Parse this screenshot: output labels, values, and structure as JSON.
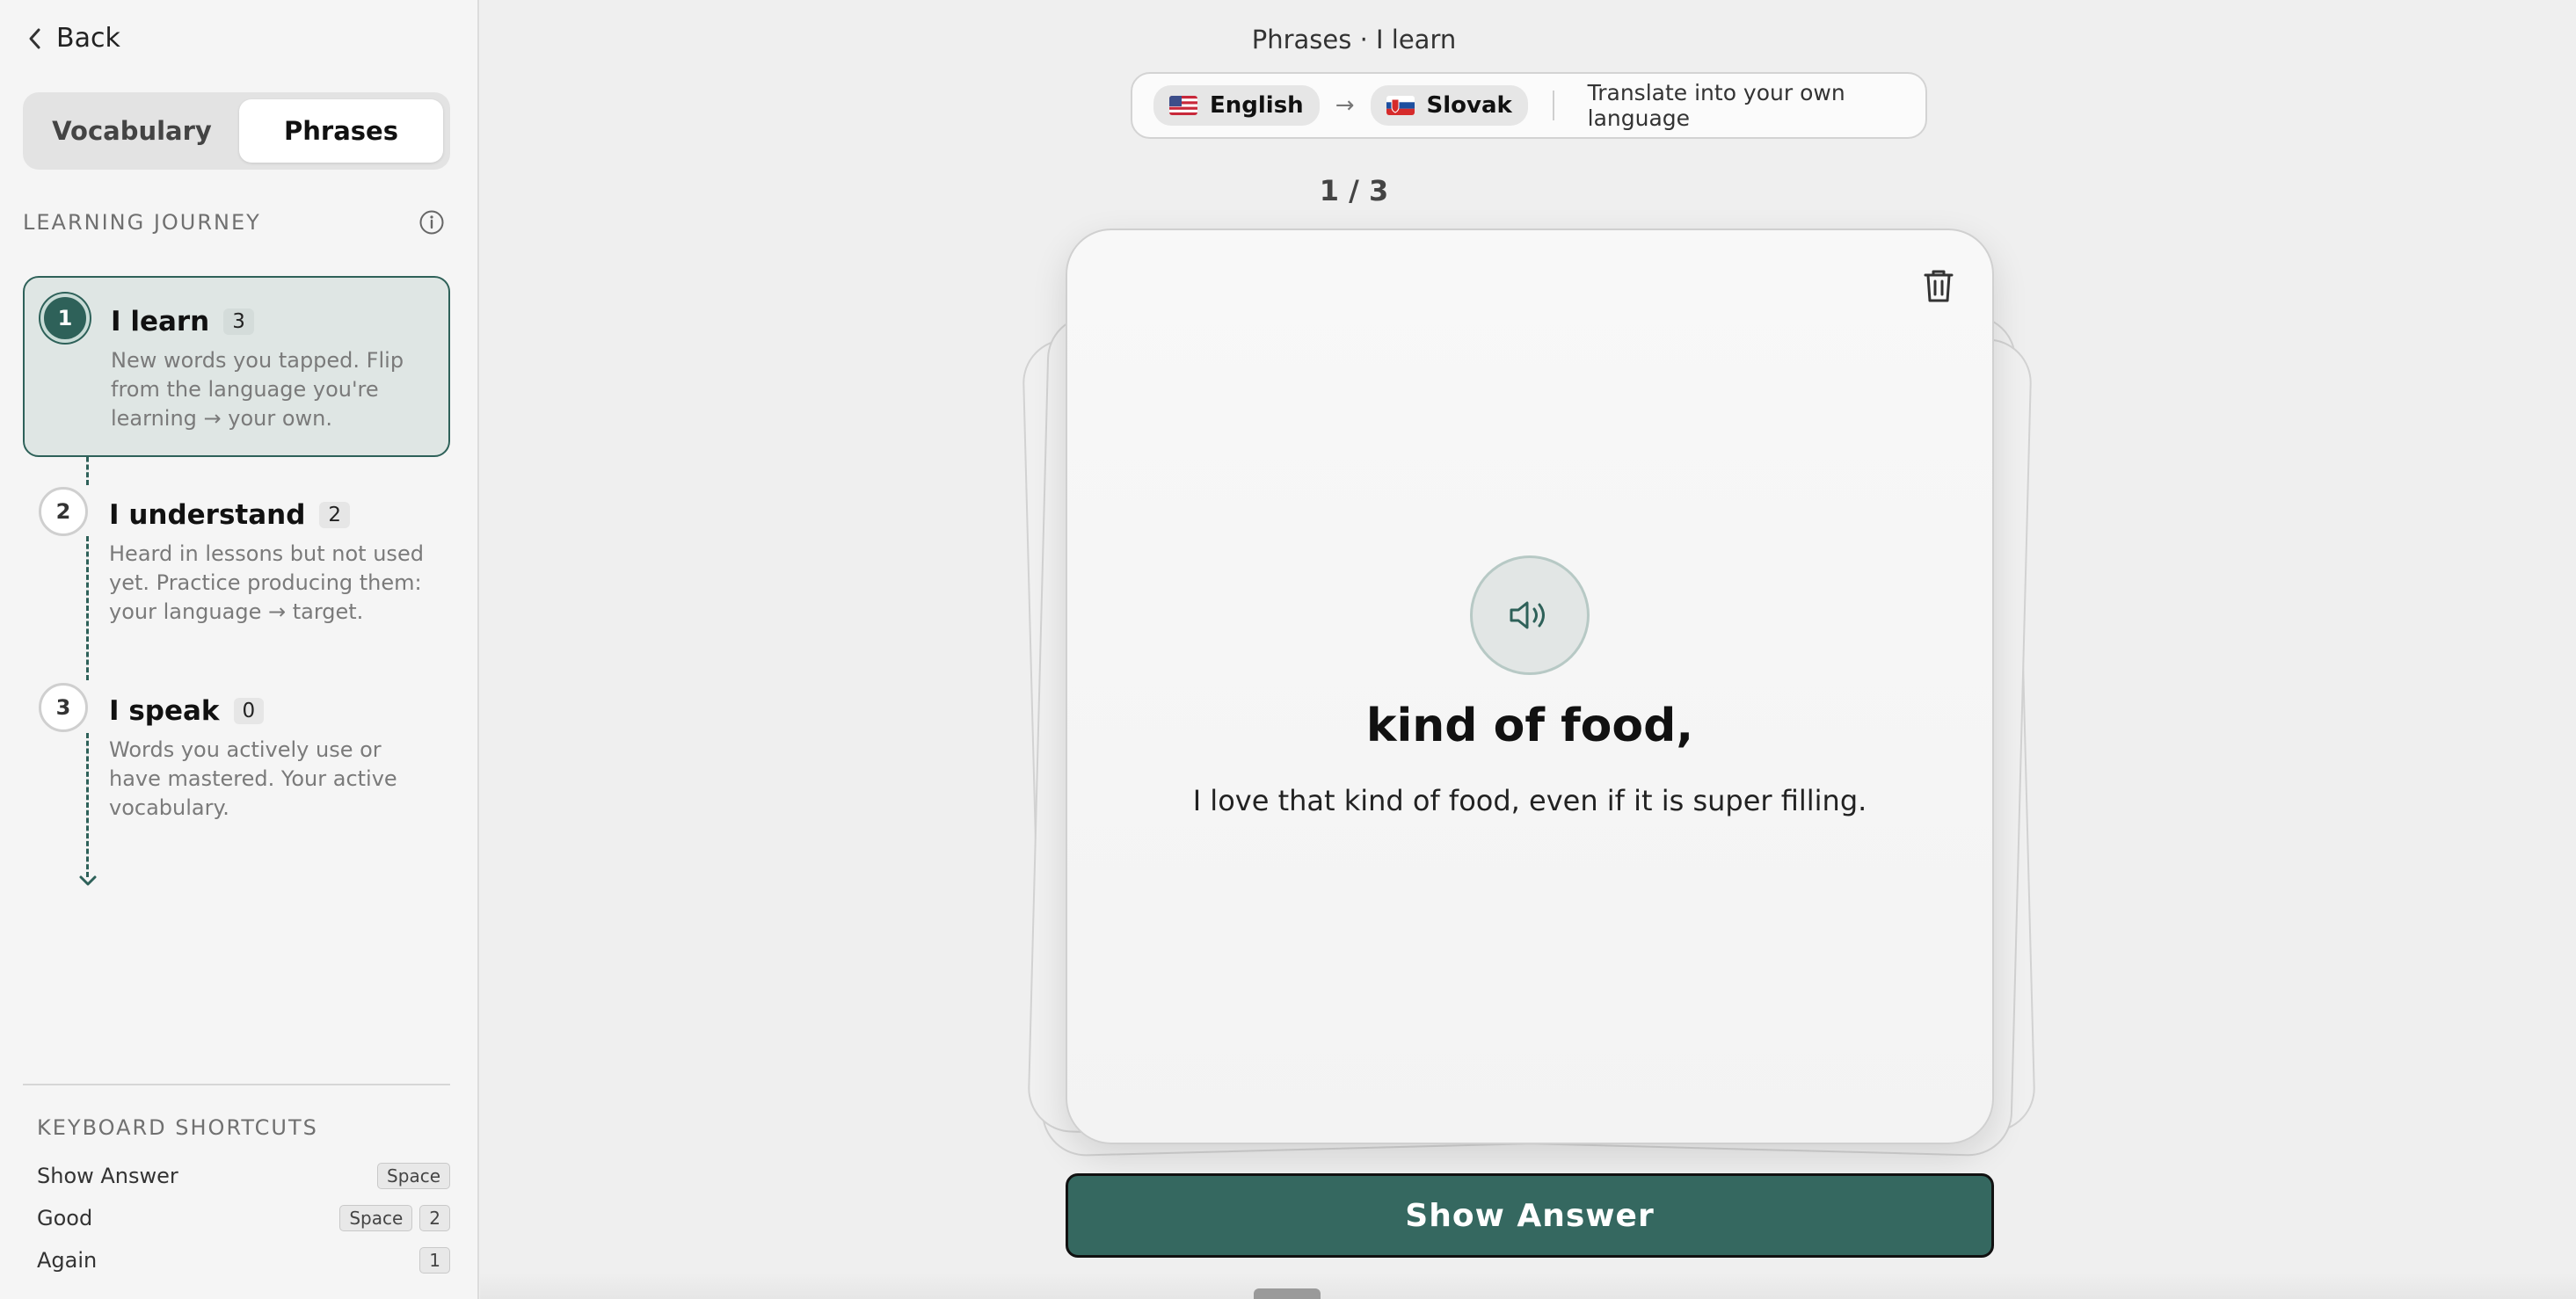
{
  "sidebar": {
    "back_label": "Back",
    "tabs": [
      {
        "label": "Vocabulary",
        "active": false
      },
      {
        "label": "Phrases",
        "active": true
      }
    ],
    "journey_title": "LEARNING JOURNEY",
    "stages": [
      {
        "number": "1",
        "title": "I learn",
        "count": "3",
        "description": "New words you tapped. Flip from the language you're learning → your own.",
        "active": true
      },
      {
        "number": "2",
        "title": "I understand",
        "count": "2",
        "description": "Heard in lessons but not used yet. Practice producing them: your language → target.",
        "active": false
      },
      {
        "number": "3",
        "title": "I speak",
        "count": "0",
        "description": "Words you actively use or have mastered. Your active vocabulary.",
        "active": false
      }
    ],
    "shortcuts_title": "KEYBOARD SHORTCUTS",
    "shortcuts": [
      {
        "action": "Show Answer",
        "keys": [
          "Space"
        ]
      },
      {
        "action": "Good",
        "keys": [
          "Space",
          "2"
        ]
      },
      {
        "action": "Again",
        "keys": [
          "1"
        ]
      }
    ]
  },
  "header": {
    "title": "Phrases · I learn",
    "source_language": "English",
    "target_language": "Slovak",
    "arrow": "→",
    "mode_label": "Translate into your own language"
  },
  "progress": "1 / 3",
  "card": {
    "term": "kind of food,",
    "sentence": "I love that kind of food, even if it is super filling."
  },
  "show_answer_label": "Show Answer",
  "colors": {
    "accent": "#2e6159",
    "button": "#356860",
    "background": "#efefef"
  }
}
